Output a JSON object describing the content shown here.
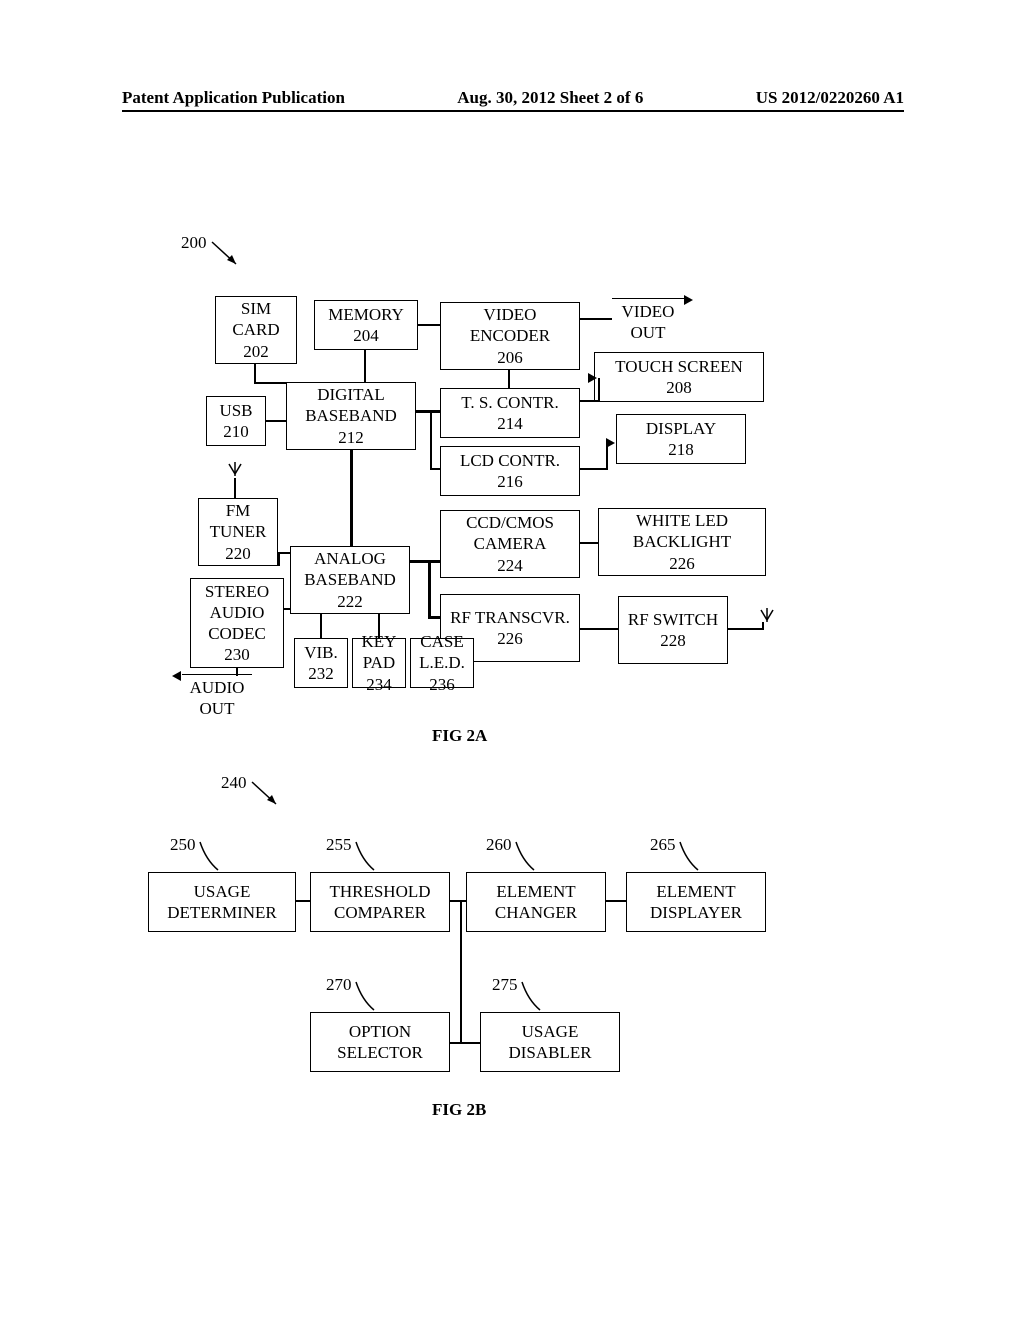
{
  "header": {
    "left": "Patent Application Publication",
    "center": "Aug. 30, 2012  Sheet 2 of 6",
    "right": "US 2012/0220260 A1"
  },
  "figA": {
    "ref200": "200",
    "sim_card": "SIM CARD\n202",
    "memory": "MEMORY\n204",
    "video_encoder": "VIDEO ENCODER\n206",
    "video_out": "VIDEO OUT",
    "touch_screen": "TOUCH SCREEN\n208",
    "usb": "USB\n210",
    "digital_baseband": "DIGITAL BASEBAND\n212",
    "ts_contr": "T. S. CONTR.\n214",
    "lcd_contr": "LCD CONTR.\n216",
    "display": "DISPLAY\n218",
    "fm_tuner": "FM TUNER\n220",
    "analog_baseband": "ANALOG BASEBAND\n222",
    "ccd_cmos": "CCD/CMOS CAMERA\n224",
    "white_led": "WHITE LED BACKLIGHT\n226",
    "rf_transcvr": "RF TRANSCVR.\n226",
    "rf_switch": "RF SWITCH\n228",
    "stereo_codec": "STEREO AUDIO CODEC\n230",
    "vib": "VIB.\n232",
    "keypad": "KEY PAD\n234",
    "case_led": "CASE L.E.D.\n236",
    "audio_out": "AUDIO OUT",
    "caption": "FIG 2A"
  },
  "figB": {
    "ref240": "240",
    "ref250": "250",
    "ref255": "255",
    "ref260": "260",
    "ref265": "265",
    "ref270": "270",
    "ref275": "275",
    "usage_determiner": "USAGE DETERMINER",
    "threshold_comparer": "THRESHOLD COMPARER",
    "element_changer": "ELEMENT CHANGER",
    "element_displayer": "ELEMENT DISPLAYER",
    "option_selector": "OPTION SELECTOR",
    "usage_disabler": "USAGE DISABLER",
    "caption": "FIG 2B"
  }
}
